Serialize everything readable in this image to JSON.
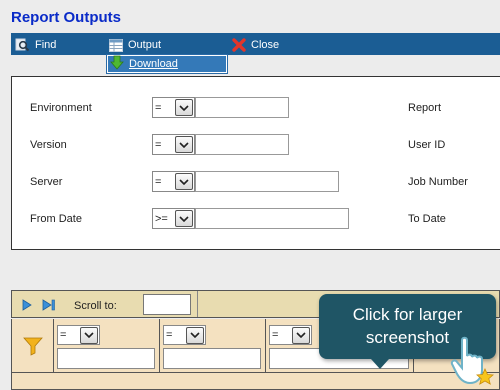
{
  "page": {
    "title": "Report Outputs"
  },
  "toolbar": {
    "find": "Find",
    "output": "Output",
    "close": "Close"
  },
  "output_menu": {
    "download": "Download"
  },
  "form": {
    "environment": {
      "label": "Environment",
      "op": "=",
      "right_label": "Report"
    },
    "version": {
      "label": "Version",
      "op": "=",
      "right_label": "User ID"
    },
    "server": {
      "label": "Server",
      "op": "=",
      "right_label": "Job Number"
    },
    "from_date": {
      "label": "From Date",
      "op": ">=",
      "right_label": "To Date"
    }
  },
  "grid": {
    "scroll_label": "Scroll to:",
    "filters": [
      {
        "op": "="
      },
      {
        "op": "="
      },
      {
        "op": "="
      }
    ]
  },
  "tooltip": {
    "line1": "Click for larger",
    "line2": "screenshot"
  },
  "colors": {
    "title": "#0a2bc8",
    "toolbar": "#1b5d94",
    "grid_header": "#f4e1c0",
    "tooltip": "#1f5565"
  }
}
